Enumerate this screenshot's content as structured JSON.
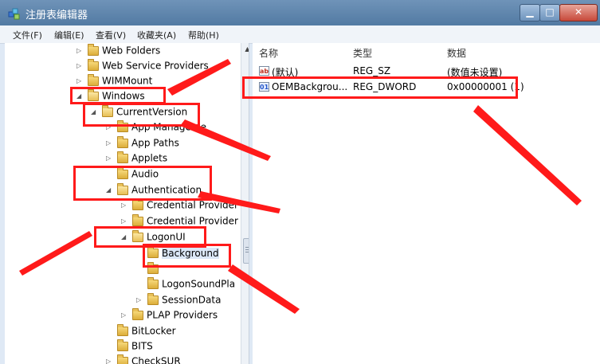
{
  "window": {
    "title": "注册表编辑器",
    "controls": {
      "minimize": "▁",
      "maximize": "□",
      "close": "✕"
    }
  },
  "menu": [
    "文件(F)",
    "编辑(E)",
    "查看(V)",
    "收藏夹(A)",
    "帮助(H)"
  ],
  "tree": [
    {
      "label": "Web Folders",
      "expander": "▷"
    },
    {
      "label": "Web Service Providers",
      "expander": "▷"
    },
    {
      "label": "WIMMount",
      "expander": "▷"
    },
    {
      "label": "Windows",
      "expander": "◢"
    },
    {
      "label": "CurrentVersion",
      "expander": "◢"
    },
    {
      "label": "App Manageme",
      "expander": "▷"
    },
    {
      "label": "App Paths",
      "expander": "▷"
    },
    {
      "label": "Applets",
      "expander": "▷"
    },
    {
      "label": "Audio",
      "expander": ""
    },
    {
      "label": "Authentication",
      "expander": "◢"
    },
    {
      "label": "Credential Provider",
      "expander": "▷"
    },
    {
      "label": "Credential Provider",
      "expander": "▷"
    },
    {
      "label": "LogonUI",
      "expander": "◢"
    },
    {
      "label": "Background",
      "expander": ""
    },
    {
      "label": "",
      "expander": ""
    },
    {
      "label": "LogonSoundPla",
      "expander": ""
    },
    {
      "label": "SessionData",
      "expander": "▷"
    },
    {
      "label": "PLAP Providers",
      "expander": "▷"
    },
    {
      "label": "BitLocker",
      "expander": ""
    },
    {
      "label": "BITS",
      "expander": ""
    },
    {
      "label": "CheckSUR",
      "expander": "▷"
    }
  ],
  "values_pane": {
    "columns": {
      "name": "名称",
      "type": "类型",
      "data": "数据"
    },
    "rows": [
      {
        "name": "(默认)",
        "type": "REG_SZ",
        "data": "(数值未设置)",
        "icon": "string-value-icon",
        "icon_glyph": "ab"
      },
      {
        "name": "OEMBackgrou...",
        "type": "REG_DWORD",
        "data": "0x00000001 (1)",
        "icon": "dword-value-icon",
        "icon_glyph": "01"
      }
    ]
  },
  "annotation_color": "#ff1a1a"
}
